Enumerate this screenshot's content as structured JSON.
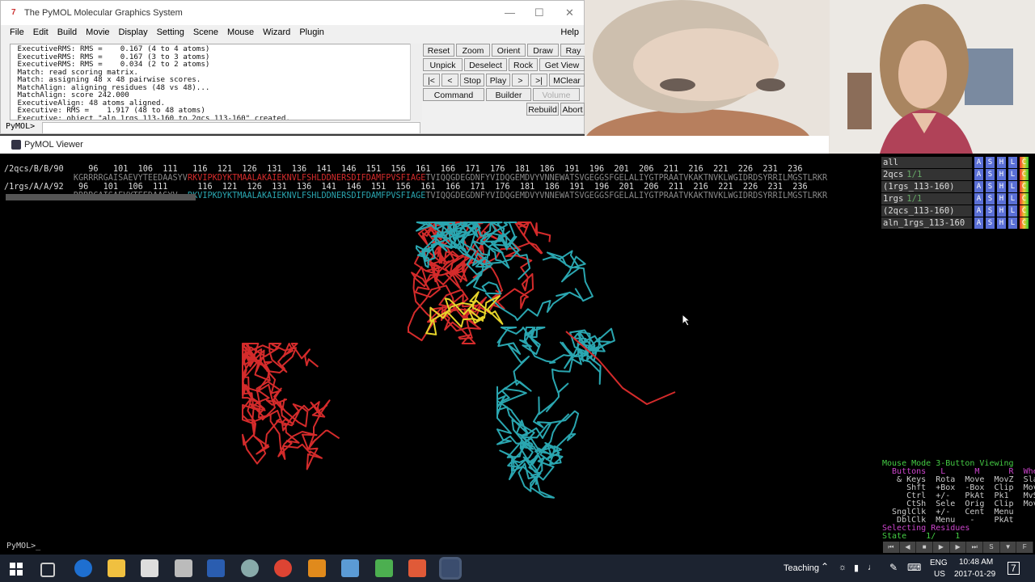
{
  "control_window": {
    "title": "The PyMOL Molecular Graphics System",
    "menu": [
      "File",
      "Edit",
      "Build",
      "Movie",
      "Display",
      "Setting",
      "Scene",
      "Mouse",
      "Wizard",
      "Plugin"
    ],
    "help": "Help",
    "log_lines": [
      " ExecutiveRMS: RMS =    0.167 (4 to 4 atoms)",
      " ExecutiveRMS: RMS =    0.167 (3 to 3 atoms)",
      " ExecutiveRMS: RMS =    0.034 (2 to 2 atoms)",
      " Match: read scoring matrix.",
      " Match: assigning 48 x 48 pairwise scores.",
      " MatchAlign: aligning residues (48 vs 48)...",
      " MatchAlign: score 242.000",
      " ExecutiveAlign: 48 atoms aligned.",
      " Executive: RMS =    1.917 (48 to 48 atoms)",
      " Executive: object \"aln_1rgs_113-160_to_2qcs_113-160\" created."
    ],
    "prompt": "PyMOL>",
    "buttons_row1": [
      "Reset",
      "Zoom",
      "Orient",
      "Draw",
      "Ray"
    ],
    "buttons_row2": [
      "Unpick",
      "Deselect",
      "Rock",
      "Get View"
    ],
    "buttons_row3": [
      "|<",
      "<",
      "Stop",
      "Play",
      ">",
      ">|",
      "MClear"
    ],
    "buttons_row4": [
      "Command",
      "Builder",
      "Volume"
    ],
    "buttons_row5": [
      "Rebuild",
      "Abort"
    ]
  },
  "viewer": {
    "title": "PyMOL Viewer",
    "seq_ruler1": "/2qcs/B/B/90     96   101  106  111   116  121  126  131  136  141  146  151  156  161  166  171  176  181  186  191  196  201  206  211  216  221  226  231  236",
    "seq1_pre": "              KGRRRRGAISAEVYTEEDAASYV",
    "seq1_red": "RKVIPKDYKTMAALAKAIEKNVLFSHLDDNERSDIFDAMFPVSFIAGE",
    "seq1_post": "TVIQQGDEGDNFYVIDQGEMDVYVNNEWATSVGEGGSFGELALIYGTPRAATVKAKTNVKLWGIDRDSYRRILMGSTLRKR",
    "seq_ruler2": "/1rgs/A/A/92   96   101  106  111      116  121  126  131  136  141  146  151  156  161  166  171  176  181  186  191  196  201  206  211  216  221  226  231  236",
    "seq2_pre": "              RRRRGAISAEVYTEEDAASYV--",
    "seq2_teal": "RKVIPKDYKTMAALAKAIEKNVLFSHLDDNERSDIFDAMFPVSFIAGE",
    "seq2_post": "TVIQQGDEGDNFYVIDQGEMDVYVNNEWATSVGEGGSFGELALIYGTPRAATVKAKTNVKLWGIDRDSYRRILMGSTLRKR",
    "objects": [
      {
        "name": "all",
        "state": ""
      },
      {
        "name": "2qcs",
        "state": "1/1"
      },
      {
        "name": "(1rgs_113-160)",
        "state": ""
      },
      {
        "name": "1rgs",
        "state": "1/1"
      },
      {
        "name": "(2qcs_113-160)",
        "state": ""
      },
      {
        "name": "aln_1rgs_113-160",
        "state": ""
      }
    ],
    "obj_buttons": [
      "A",
      "S",
      "H",
      "L",
      "C"
    ],
    "mouse_panel": [
      "Mouse Mode 3-Button Viewing",
      "  Buttons   L      M      R  Wheel",
      "   & Keys  Rota  Move  MovZ  Slab",
      "     Shft  +Box  -Box  Clip  MovS",
      "     Ctrl  +/-   PkAt  Pk1   MvSZ",
      "     CtSh  Sele  Orig  Clip  MovZ",
      "  SnglClk  +/-   Cent  Menu",
      "   DblClk  Menu   -    PkAt",
      "Selecting Residues",
      "State    1/    1"
    ],
    "prompt": "PyMOL>_",
    "colors": {
      "red": "#d42b2b",
      "teal": "#2aa6b0",
      "yellow": "#e6d42a"
    }
  },
  "taskbar": {
    "label": "Teaching",
    "lang": "ENG",
    "region": "US",
    "time": "10:48 AM",
    "date": "2017-01-29",
    "notif": "7"
  }
}
